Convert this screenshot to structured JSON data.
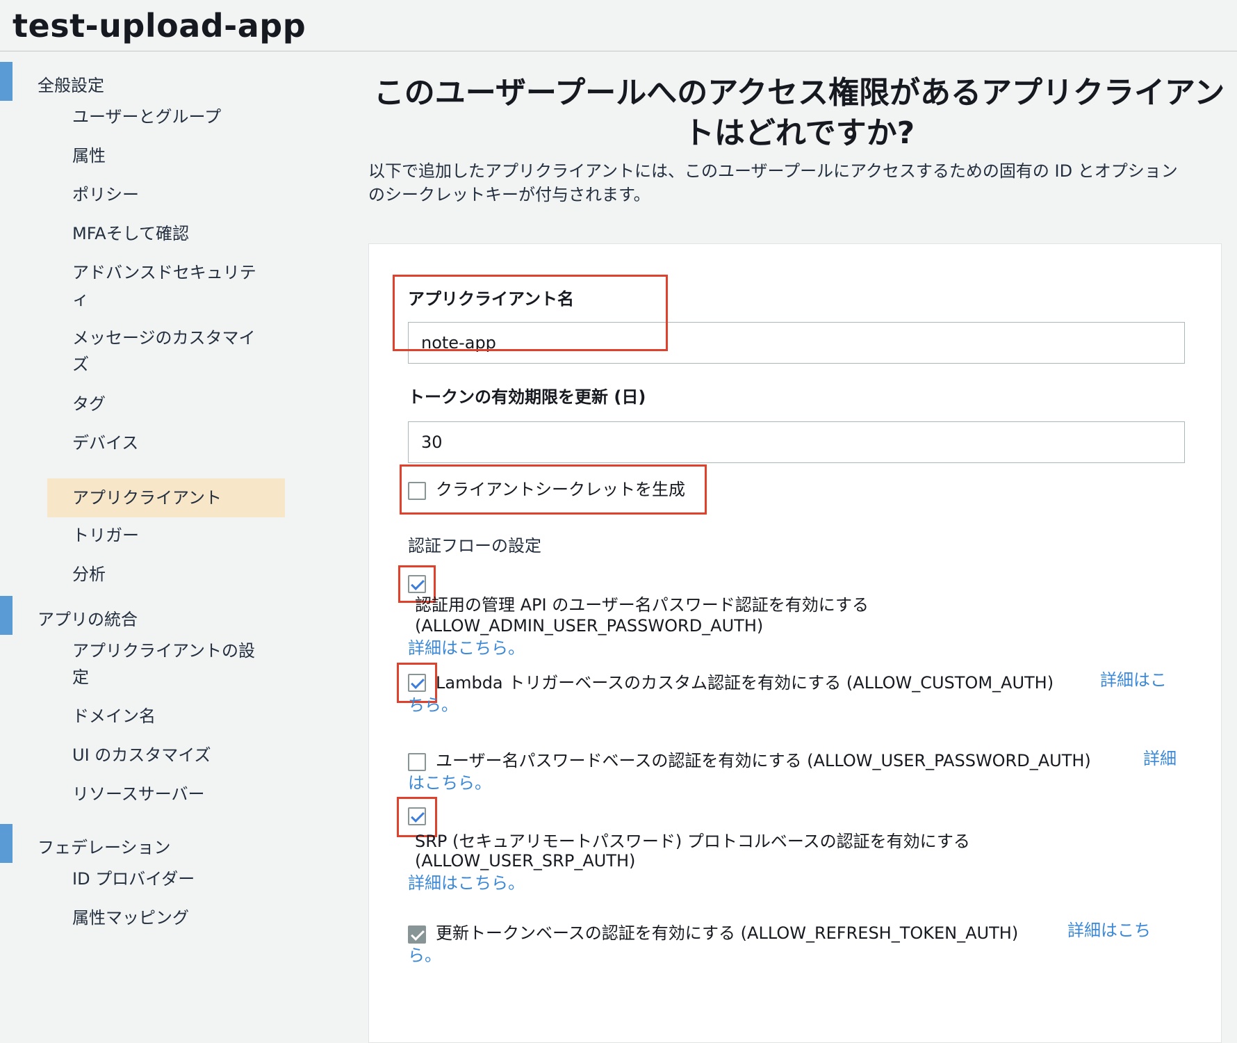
{
  "header": {
    "top_fragment": "",
    "app_title": "test-upload-app"
  },
  "sidebar": {
    "sections": [
      {
        "label": "全般設定"
      },
      {
        "label": "アプリの統合"
      },
      {
        "label": "フェデレーション"
      }
    ],
    "general_items": [
      "ユーザーとグループ",
      "属性",
      "ポリシー",
      "MFAそして確認",
      "アドバンスドセキュリテ",
      "ィ",
      "メッセージのカスタマイ",
      "ズ",
      "タグ",
      "デバイス",
      "アプリクライアント",
      "トリガー",
      "分析"
    ],
    "integration_items": [
      "アプリクライアントの設",
      "定",
      "ドメイン名",
      "UI のカスタマイズ",
      "リソースサーバー"
    ],
    "federation_items": [
      "ID プロバイダー",
      "属性マッピング"
    ]
  },
  "main": {
    "title_line1": "このユーザープールへのアクセス権限があるアプリクライアン",
    "title_line2": "トはどれですか?",
    "desc_line1": "以下で追加したアプリクライアントには、このユーザープールにアクセスするための固有の ID とオプション",
    "desc_line2": "のシークレットキーが付与されます。"
  },
  "form": {
    "app_client_name_label": "アプリクライアント名",
    "app_client_name_value": "note-app",
    "token_expiry_label": "トークンの有効期限を更新 (日)",
    "token_expiry_value": "30",
    "generate_secret_label": "クライアントシークレットを生成",
    "auth_flow_label": "認証フローの設定",
    "learn_more": "詳細はこちら。",
    "options": [
      {
        "line1": "認証用の管理 API のユーザー名パスワード認証を有効にする",
        "line2": "(ALLOW_ADMIN_USER_PASSWORD_AUTH)",
        "checked": true
      },
      {
        "line1": "Lambda トリガーベースのカスタム認証を有効にする (ALLOW_CUSTOM_AUTH)",
        "link_a": "詳細はこ",
        "link_b": "ちら。",
        "checked": true
      },
      {
        "line1": "ユーザー名パスワードベースの認証を有効にする (ALLOW_USER_PASSWORD_AUTH)",
        "link_a": "詳細",
        "link_b": "はこちら。",
        "checked": false
      },
      {
        "line1": "SRP (セキュアリモートパスワード) プロトコルベースの認証を有効にする",
        "line2": "(ALLOW_USER_SRP_AUTH)",
        "checked": true
      },
      {
        "line1": "更新トークンベースの認証を有効にする (ALLOW_REFRESH_TOKEN_AUTH)",
        "link_a": "詳細はこち",
        "link_b": "ら。",
        "checked": true
      }
    ]
  },
  "colors": {
    "accent_bar": "#5a9bd5",
    "active_item_bg": "#f7e6c8",
    "highlight_border": "#e0412d",
    "link": "#3b88d6"
  }
}
